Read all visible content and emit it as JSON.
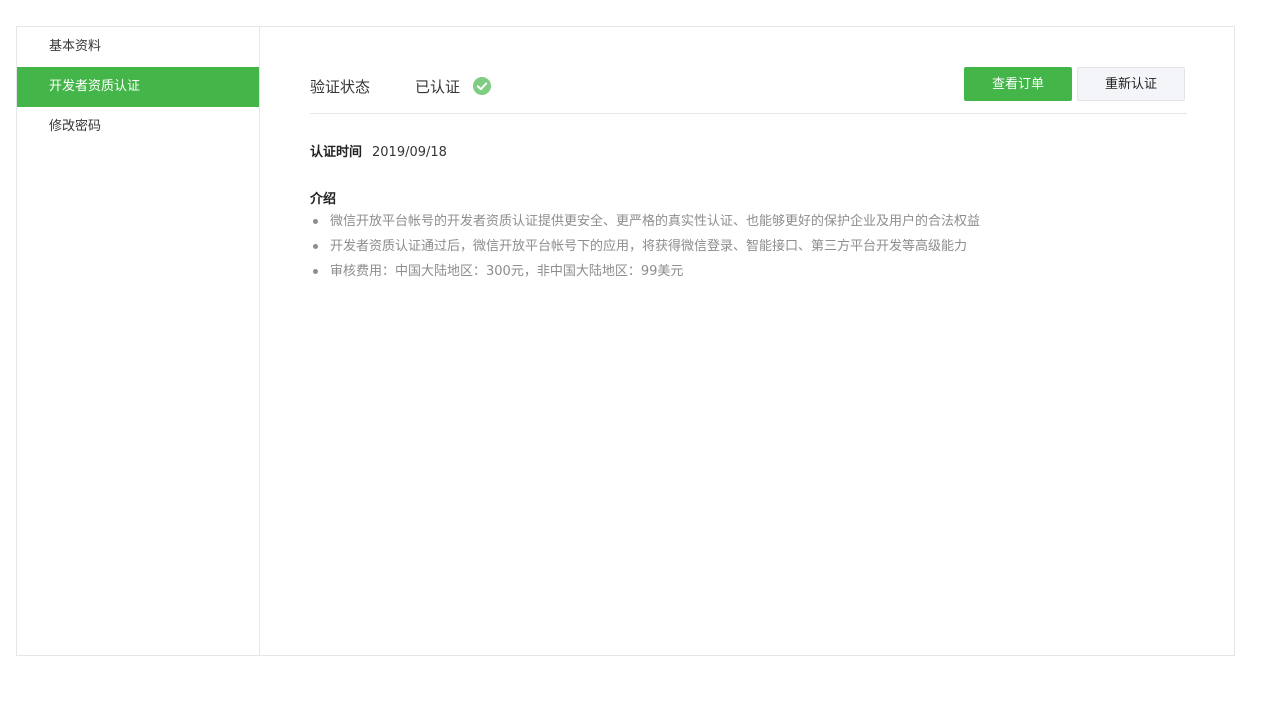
{
  "sidebar": {
    "items": [
      {
        "label": "基本资料",
        "active": false
      },
      {
        "label": "开发者资质认证",
        "active": true
      },
      {
        "label": "修改密码",
        "active": false
      }
    ]
  },
  "status": {
    "label": "验证状态",
    "value": "已认证",
    "icon": "check-circle-icon",
    "icon_color": "#7fcc83"
  },
  "buttons": {
    "view_orders": "查看订单",
    "reverify": "重新认证"
  },
  "verification_time": {
    "label": "认证时间",
    "value": "2019/09/18"
  },
  "intro": {
    "title": "介绍",
    "items": [
      "微信开放平台帐号的开发者资质认证提供更安全、更严格的真实性认证、也能够更好的保护企业及用户的合法权益",
      "开发者资质认证通过后，微信开放平台帐号下的应用，将获得微信登录、智能接口、第三方平台开发等高级能力",
      "审核费用：中国大陆地区：300元，非中国大陆地区：99美元"
    ]
  },
  "colors": {
    "accent": "#44b549",
    "text": "#353535",
    "muted": "#8d8d8d",
    "border": "#e4e6e9"
  }
}
